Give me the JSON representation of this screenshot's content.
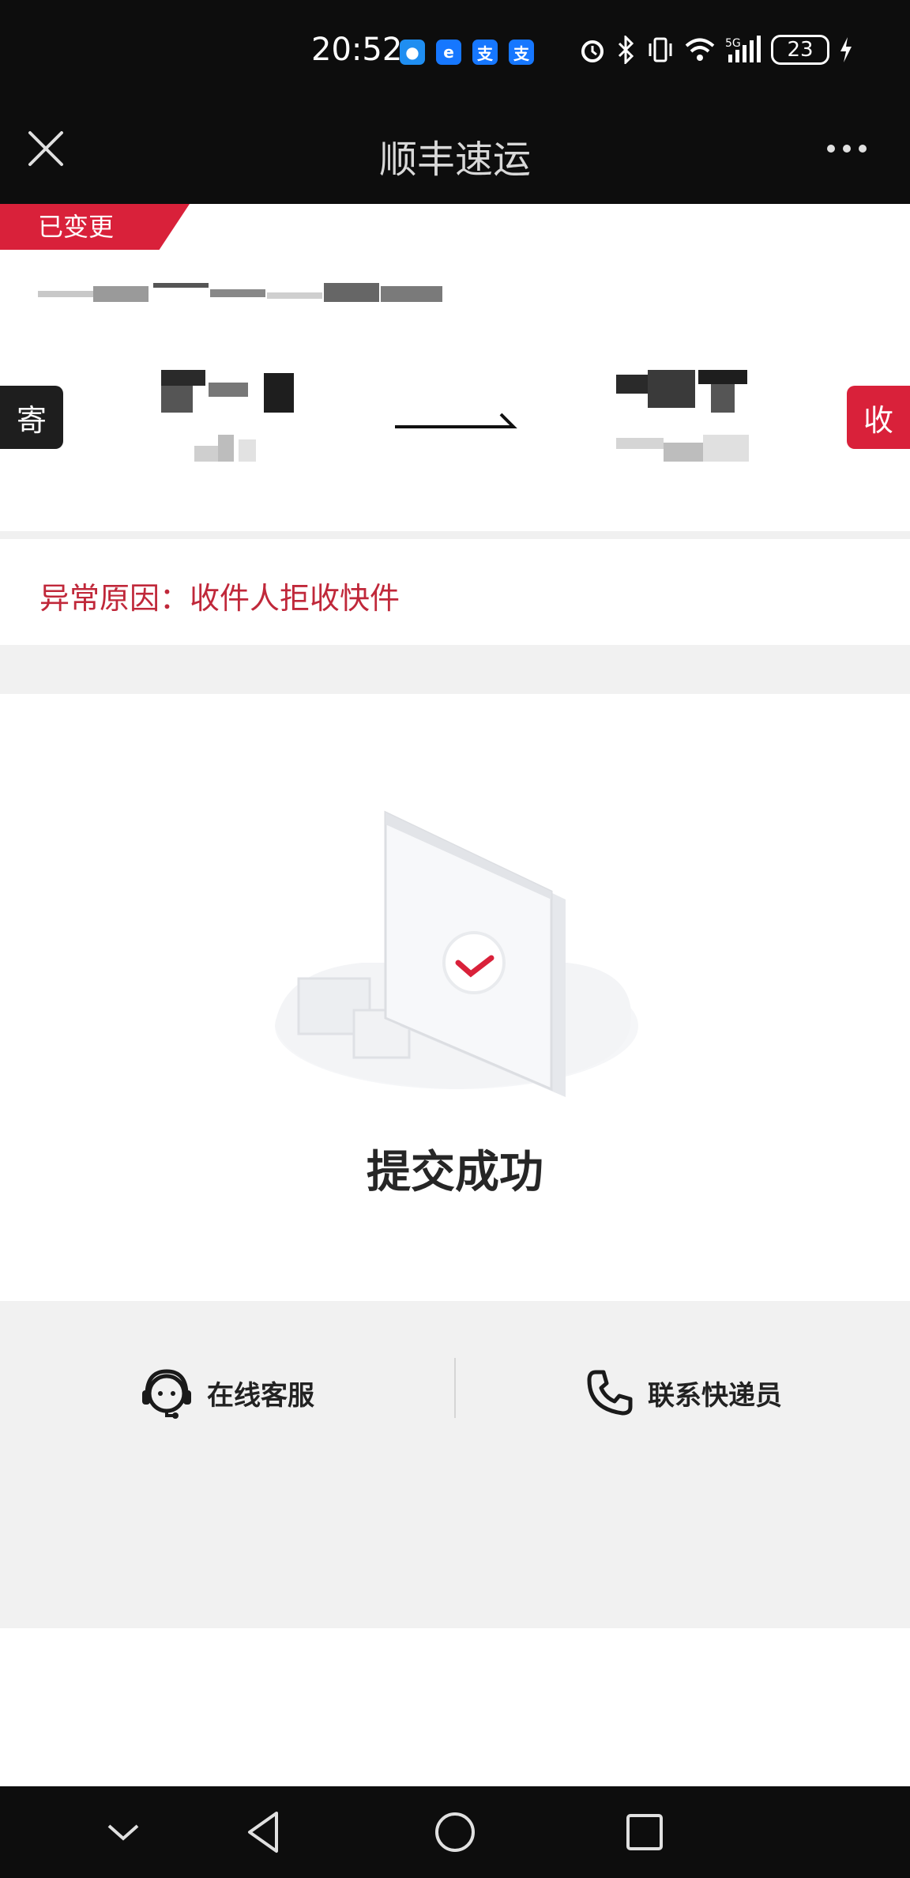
{
  "status_bar": {
    "time": "20:52",
    "battery": "23",
    "notifications": [
      {
        "icon": "message-icon",
        "glyph": "●",
        "color": "#1f8ef1"
      },
      {
        "icon": "app-icon",
        "glyph": "e",
        "color": "#1677ff"
      },
      {
        "icon": "alipay-icon",
        "glyph": "支",
        "color": "#1677ff"
      },
      {
        "icon": "alipay-icon",
        "glyph": "支",
        "color": "#1677ff"
      }
    ],
    "network": "5G"
  },
  "app_bar": {
    "title": "顺丰速运"
  },
  "shipment": {
    "status_tag": "已变更",
    "sender_label": "寄",
    "receiver_label": "收"
  },
  "exception": {
    "reason": "异常原因：收件人拒收快件"
  },
  "result": {
    "title": "提交成功"
  },
  "actions": {
    "online_service": "在线客服",
    "contact_courier": "联系快递员"
  },
  "colors": {
    "brand_red": "#d9213a",
    "reason_red": "#c0283a",
    "dark": "#0d0d0d"
  }
}
